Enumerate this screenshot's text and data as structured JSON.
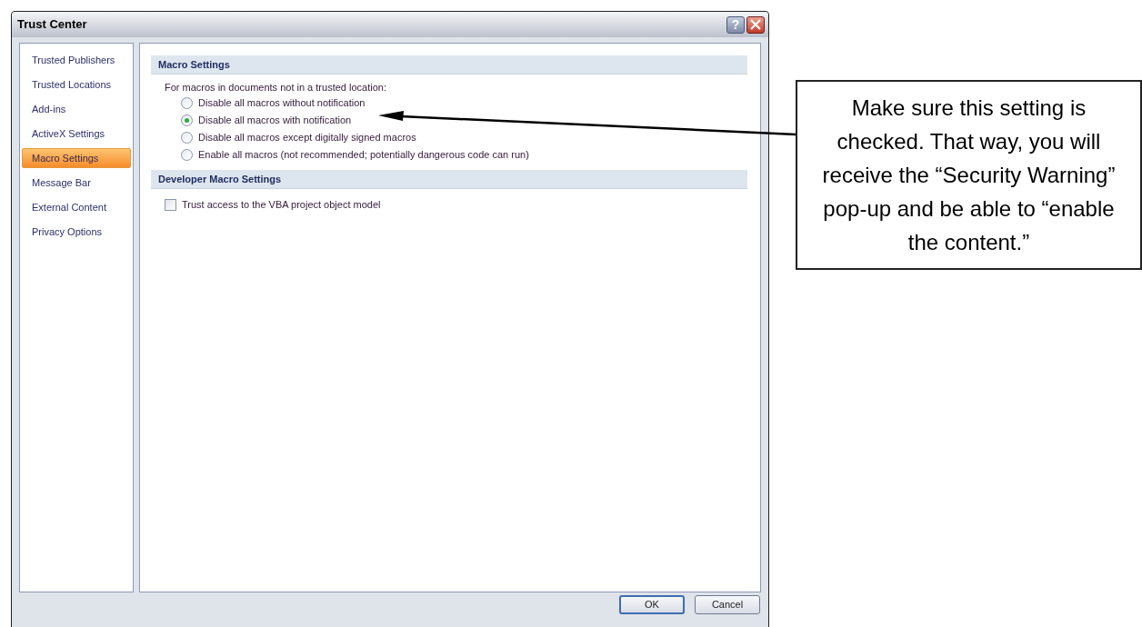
{
  "window": {
    "title": "Trust Center",
    "help": "?"
  },
  "sidebar": {
    "items": [
      {
        "label": "Trusted Publishers",
        "selected": false
      },
      {
        "label": "Trusted Locations",
        "selected": false
      },
      {
        "label": "Add-ins",
        "selected": false
      },
      {
        "label": "ActiveX Settings",
        "selected": false
      },
      {
        "label": "Macro Settings",
        "selected": true
      },
      {
        "label": "Message Bar",
        "selected": false
      },
      {
        "label": "External Content",
        "selected": false
      },
      {
        "label": "Privacy Options",
        "selected": false
      }
    ]
  },
  "sections": [
    {
      "title": "Macro Settings",
      "intro": "For macros in documents not in a trusted location:",
      "options": [
        {
          "kind": "radio",
          "label": "Disable all macros without notification",
          "checked": false
        },
        {
          "kind": "radio",
          "label": "Disable all macros with notification",
          "checked": true
        },
        {
          "kind": "radio",
          "label": "Disable all macros except digitally signed macros",
          "checked": false
        },
        {
          "kind": "radio",
          "label": "Enable all macros (not recommended; potentially dangerous code can run)",
          "checked": false
        }
      ]
    },
    {
      "title": "Developer Macro Settings",
      "options": [
        {
          "kind": "checkbox",
          "label": "Trust access to the VBA project object model",
          "checked": false
        }
      ]
    }
  ],
  "buttons": [
    "OK",
    "Cancel"
  ],
  "callout": {
    "text": "Make sure this setting is checked. That way, you will receive the “Security Warning” pop-up and be able to “enable the content.”"
  }
}
